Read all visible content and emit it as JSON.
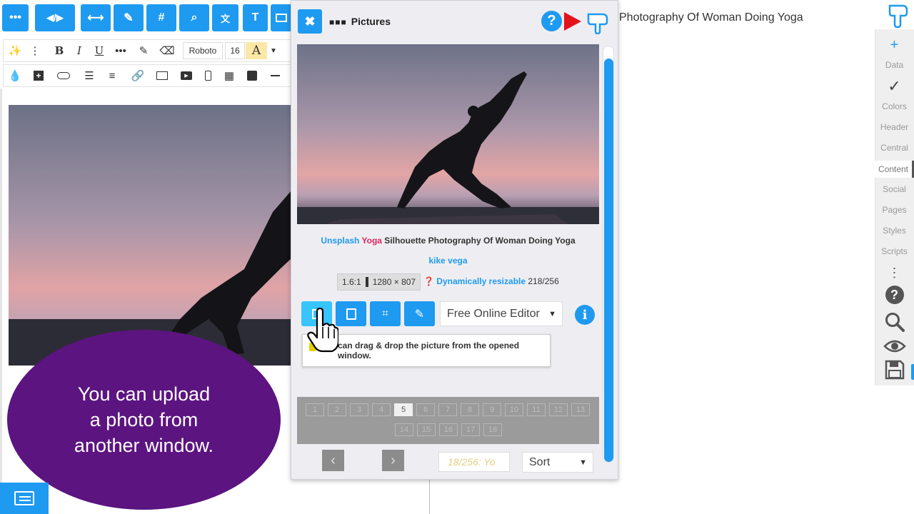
{
  "toolbar": {
    "buttons": [
      {
        "name": "menu-dots",
        "glyph": "•••"
      },
      {
        "name": "code-toggle",
        "glyph": "◀/▶"
      },
      {
        "name": "width-toggle",
        "glyph": "⟷"
      },
      {
        "name": "brush",
        "glyph": "✎"
      },
      {
        "name": "hash",
        "glyph": "#"
      },
      {
        "name": "search",
        "glyph": "⌕"
      },
      {
        "name": "translate",
        "glyph": "文"
      },
      {
        "name": "text",
        "glyph": "T"
      }
    ]
  },
  "format": {
    "bold": "B",
    "italic": "I",
    "underline": "U",
    "font_family": "Roboto",
    "font_size": "16",
    "text_color": "A"
  },
  "bubble": {
    "text": "You can upload a photo from another window."
  },
  "panel": {
    "title": "Pictures",
    "help": "?",
    "caption": {
      "source": "Unsplash",
      "keyword": "Yoga",
      "title": "Silhouette Photography Of Woman Doing Yoga"
    },
    "author": "kike vega",
    "ratio": "1.6:1",
    "dimensions": "1280 × 807",
    "resizable": "Dynamically resizable",
    "count": "218/256",
    "editor_select": "Free Online Editor",
    "info": "i",
    "tooltip": "can drag & drop the picture from the opened window.",
    "pages_row1": [
      "1",
      "2",
      "3",
      "4",
      "5",
      "6",
      "7",
      "8",
      "9",
      "10",
      "11",
      "12",
      "13"
    ],
    "pages_row2": [
      "14",
      "15",
      "16",
      "17",
      "18"
    ],
    "current_page": "5",
    "counter_placeholder": "18/256: Yo",
    "sort": "Sort",
    "prev": "‹",
    "next": "›"
  },
  "right": {
    "page_title": "Photography Of Woman Doing Yoga",
    "sidebar": {
      "plus": "+",
      "check": "✓",
      "items": [
        "Data",
        "Colors",
        "Header",
        "Central",
        "Content",
        "Social",
        "Pages",
        "Styles",
        "Scripts"
      ],
      "active": "Content",
      "more": "⋮",
      "help": "?"
    }
  },
  "colors": {
    "accent": "#1e9af0",
    "bubble": "#5c1480",
    "keyword": "#e0245e",
    "alert": "#e3121b"
  }
}
